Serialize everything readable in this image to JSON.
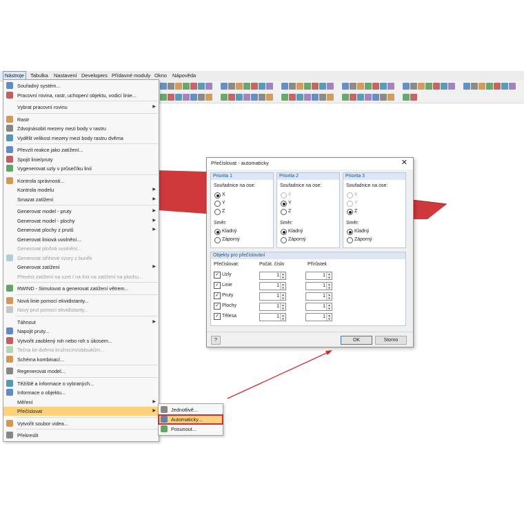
{
  "menubar": {
    "items": [
      "Nástroje",
      "Tabulka",
      "Nastavení",
      "Developers",
      "Přídavné moduly",
      "Okno",
      "Nápověda"
    ]
  },
  "menu": {
    "items": [
      {
        "label": "Souřadný systém...",
        "icon": "coordinate-system-icon"
      },
      {
        "label": "Pracovní rovina, rastr, uchopení objektu, vodicí linie...",
        "icon": "work-plane-icon"
      },
      {
        "label": "Vybrat pracovní rovinu",
        "icon": "",
        "submenu": true
      },
      {
        "label": "Rastr",
        "icon": "grid-icon"
      },
      {
        "label": "Zdvojnásobit mezery mezi body v rastru",
        "icon": "grid-double-icon"
      },
      {
        "label": "Vydělit velikost mezery mezi body rastru dvěma",
        "icon": "grid-divide-icon"
      },
      {
        "label": "Převzít reakce jako zatížení...",
        "icon": "reactions-icon"
      },
      {
        "label": "Spojit linie/pruty",
        "icon": "connect-lines-icon"
      },
      {
        "label": "Vygenerovat uzly v průsečíku linií",
        "icon": "intersection-icon"
      },
      {
        "label": "Kontrola správnosti...",
        "icon": "check-icon"
      },
      {
        "label": "Kontrola modelu",
        "icon": "",
        "submenu": true
      },
      {
        "label": "Smazat zatížení",
        "icon": "",
        "submenu": true
      },
      {
        "label": "Generovat model - pruty",
        "icon": "",
        "submenu": true
      },
      {
        "label": "Generovat model - plochy",
        "icon": "",
        "submenu": true
      },
      {
        "label": "Generovat plochy z prutů",
        "icon": "",
        "submenu": true
      },
      {
        "label": "Generovat liniová uvolnění...",
        "icon": ""
      },
      {
        "label": "Generovat plošná uvolnění...",
        "icon": "",
        "disabled": true
      },
      {
        "label": "Generovat střihové vzory z buněk",
        "icon": "shear-pattern-icon",
        "disabled": true
      },
      {
        "label": "Generovat zatížení",
        "icon": "",
        "submenu": true
      },
      {
        "label": "Převést zatížení na uzel / na linii na zatížení na plochu...",
        "icon": "",
        "disabled": true
      },
      {
        "label": "RWIND - Simulovat a generovat zatížení větrem...",
        "icon": "rwind-icon"
      },
      {
        "label": "Nová linie pomocí ekvidistanty...",
        "icon": "new-line-icon"
      },
      {
        "label": "Nový prut pomocí ekvidistanty...",
        "icon": "new-member-icon",
        "disabled": true
      },
      {
        "label": "Táhnout",
        "icon": "",
        "submenu": true
      },
      {
        "label": "Napojit pruty...",
        "icon": "connect-members-icon"
      },
      {
        "label": "Vytvořit zaoblený roh nebo roh s úkosem...",
        "icon": "round-corner-icon"
      },
      {
        "label": "Tečna ke dvěma kružnicím/obloukům...",
        "icon": "tangent-icon",
        "disabled": true
      },
      {
        "label": "Schéma kombinací...",
        "icon": "combination-icon"
      },
      {
        "label": "Regenerovat model...",
        "icon": "regenerate-icon"
      },
      {
        "label": "Těžiště a informace o vybraných...",
        "icon": "centroid-icon"
      },
      {
        "label": "Informace o objektu...",
        "icon": "info-icon"
      },
      {
        "label": "Měření",
        "icon": "",
        "submenu": true
      },
      {
        "label": "Přečíslovat",
        "icon": "",
        "submenu": true,
        "highlighted": true
      },
      {
        "label": "Vytvořit soubor videa...",
        "icon": "video-icon"
      },
      {
        "label": "Překreslit",
        "icon": "redraw-icon"
      }
    ]
  },
  "submenu": {
    "items": [
      {
        "label": "Jednotlivě...",
        "icon": "renumber-single-icon"
      },
      {
        "label": "Automaticky...",
        "icon": "renumber-auto-icon",
        "highlighted": true
      },
      {
        "label": "Posunout...",
        "icon": "renumber-shift-icon"
      }
    ]
  },
  "dialog": {
    "title": "Přečíslovat - automaticky",
    "priorities": [
      {
        "title": "Priorita 1",
        "axis_label": "Souřadnice na ose:",
        "axes": [
          "X",
          "Y",
          "Z"
        ],
        "selected_axis": "X",
        "disabled_axes": [],
        "direction_label": "Směr:",
        "directions": [
          "Kladný",
          "Záporný"
        ],
        "selected_direction": "Kladný"
      },
      {
        "title": "Priorita 2",
        "axis_label": "Souřadnice na ose:",
        "axes": [
          "X",
          "Y",
          "Z"
        ],
        "selected_axis": "Y",
        "disabled_axes": [
          "X"
        ],
        "direction_label": "Směr:",
        "directions": [
          "Kladný",
          "Záporný"
        ],
        "selected_direction": "Kladný"
      },
      {
        "title": "Priorita 3",
        "axis_label": "Souřadnice na ose:",
        "axes": [
          "X",
          "Y",
          "Z"
        ],
        "selected_axis": "Z",
        "disabled_axes": [
          "X",
          "Y"
        ],
        "direction_label": "Směr:",
        "directions": [
          "Kladný",
          "Záporný"
        ],
        "selected_direction": "Kladný"
      }
    ],
    "objects": {
      "title": "Objekty pro přečíslování",
      "col_renumber": "Přečíslovat:",
      "col_start": "Počát. číslo",
      "col_increment": "Přírůstek",
      "rows": [
        {
          "label": "Uzly",
          "checked": true,
          "start": "1",
          "increment": "1"
        },
        {
          "label": "Linie",
          "checked": true,
          "start": "1",
          "increment": "1"
        },
        {
          "label": "Pruty",
          "checked": true,
          "start": "1",
          "increment": "1"
        },
        {
          "label": "Plochy",
          "checked": true,
          "start": "1",
          "increment": "1"
        },
        {
          "label": "Tělesa",
          "checked": true,
          "start": "1",
          "increment": "1"
        }
      ]
    },
    "ok_label": "OK",
    "cancel_label": "Storno",
    "close_glyph": "✕",
    "help_icon": "help-icon"
  },
  "colors": {
    "surface": "#d0393b",
    "highlight": "#fbd27a",
    "annotation": "#d72b2b",
    "group_header": "#dde7f3"
  }
}
